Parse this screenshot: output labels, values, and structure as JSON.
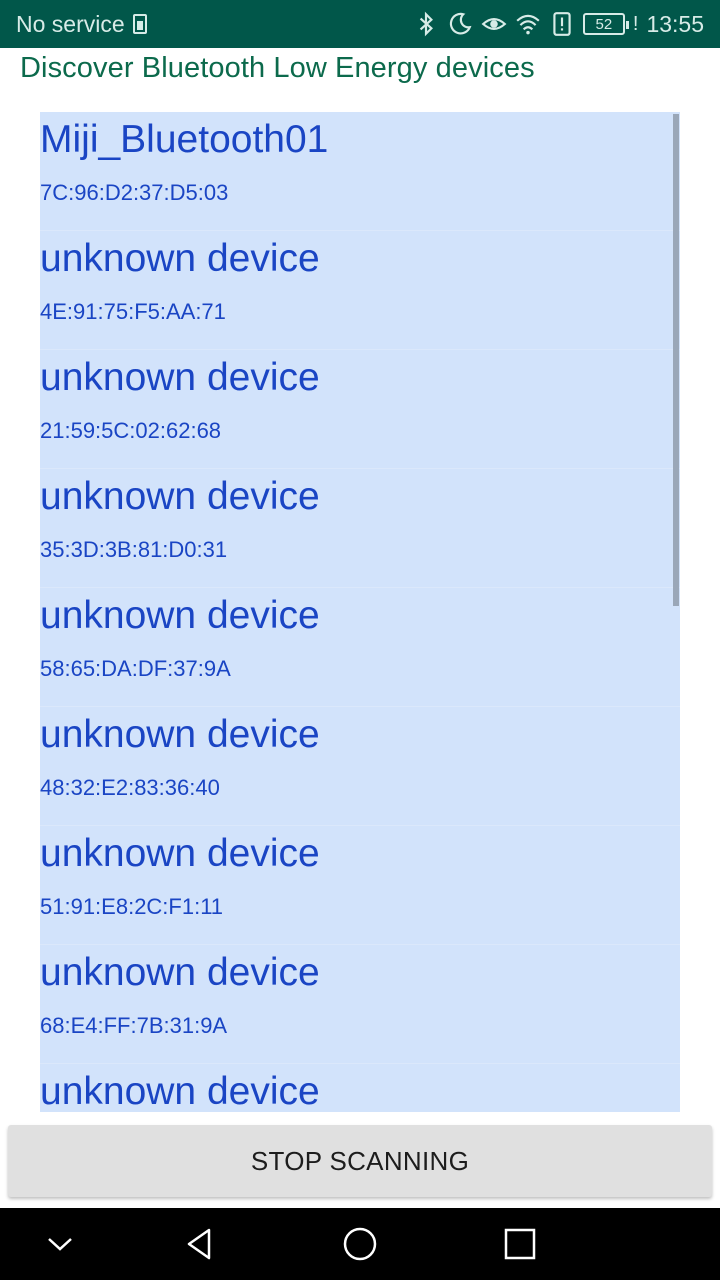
{
  "status_bar": {
    "carrier": "No service",
    "battery_level": "52",
    "time": "13:55",
    "icons": [
      "sim-icon",
      "bluetooth-icon",
      "moon-icon",
      "eye-icon",
      "wifi-icon",
      "alert-icon",
      "battery-icon",
      "signal-icon"
    ]
  },
  "title": "Discover Bluetooth Low Energy devices",
  "devices": [
    {
      "name": "Miji_Bluetooth01",
      "mac": "7C:96:D2:37:D5:03"
    },
    {
      "name": "unknown device",
      "mac": "4E:91:75:F5:AA:71"
    },
    {
      "name": "unknown device",
      "mac": "21:59:5C:02:62:68"
    },
    {
      "name": "unknown device",
      "mac": "35:3D:3B:81:D0:31"
    },
    {
      "name": "unknown device",
      "mac": "58:65:DA:DF:37:9A"
    },
    {
      "name": "unknown device",
      "mac": "48:32:E2:83:36:40"
    },
    {
      "name": "unknown device",
      "mac": "51:91:E8:2C:F1:11"
    },
    {
      "name": "unknown device",
      "mac": "68:E4:FF:7B:31:9A"
    },
    {
      "name": "unknown device",
      "mac": ""
    }
  ],
  "stop_button_label": "STOP SCANNING",
  "colors": {
    "status_bar_bg": "#01574a",
    "title_color": "#0c6a4c",
    "list_bg": "#d2e3fb",
    "device_text": "#1a45c4",
    "button_bg": "#e0e0e0"
  },
  "nav": {
    "icons": [
      "chevron-down-icon",
      "back-icon",
      "home-icon",
      "recents-icon"
    ]
  }
}
